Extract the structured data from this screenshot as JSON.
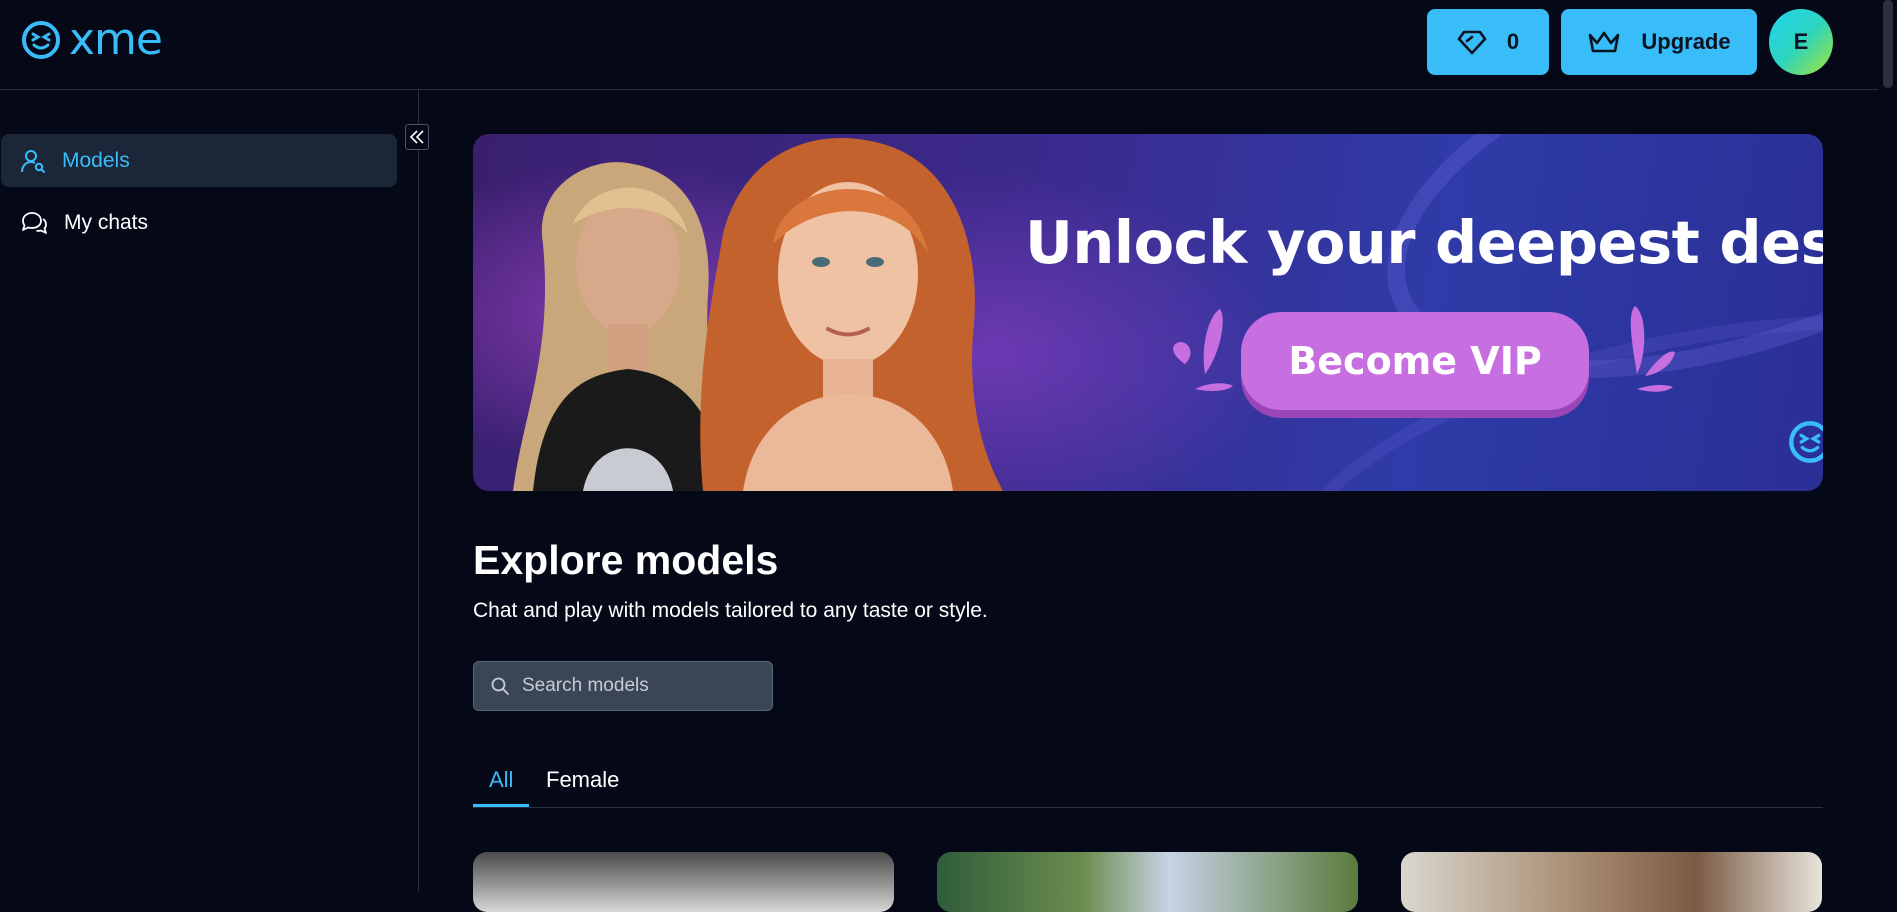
{
  "header": {
    "logo_text": "xme",
    "gems_count": "0",
    "upgrade_label": "Upgrade",
    "avatar_initial": "E"
  },
  "sidebar": {
    "items": [
      {
        "label": "Models",
        "icon": "user-search-icon",
        "active": true
      },
      {
        "label": "My chats",
        "icon": "chat-bubbles-icon",
        "active": false
      }
    ]
  },
  "banner": {
    "headline": "Unlock your deepest desires",
    "cta_label": "Become VIP"
  },
  "explore": {
    "title": "Explore models",
    "subtitle": "Chat and play with models tailored to any taste or style.",
    "search_placeholder": "Search models"
  },
  "tabs": [
    {
      "label": "All",
      "active": true
    },
    {
      "label": "Female",
      "active": false
    }
  ],
  "colors": {
    "background": "#050816",
    "accent": "#38bdf8",
    "vip_button": "#c76ee0"
  }
}
